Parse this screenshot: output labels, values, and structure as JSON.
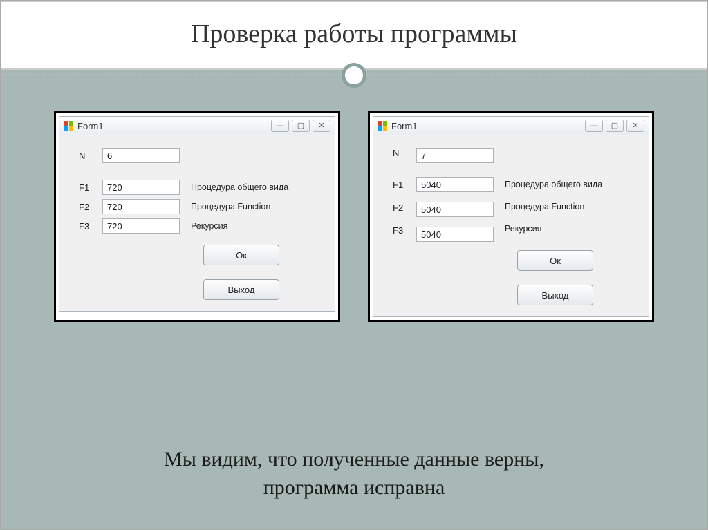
{
  "slide": {
    "title": "Проверка работы программы",
    "caption_l1": "Мы видим, что полученные данные верны,",
    "caption_l2": "программа исправна"
  },
  "window_controls": {
    "minimize": "—",
    "maximize": "▢",
    "close": "✕"
  },
  "form1": {
    "title": "Form1",
    "n_label": "N",
    "n_value": "6",
    "rows": [
      {
        "label": "F1",
        "value": "720",
        "desc": "Процедура общего вида"
      },
      {
        "label": "F2",
        "value": "720",
        "desc": "Процедура Function"
      },
      {
        "label": "F3",
        "value": "720",
        "desc": "Рекурсия"
      }
    ],
    "ok": "Ок",
    "exit": "Выход"
  },
  "form2": {
    "title": "Form1",
    "n_label": "N",
    "n_value": "7",
    "rows": [
      {
        "label": "F1",
        "value": "5040",
        "desc": "Процедура общего вида"
      },
      {
        "label": "F2",
        "value": "5040",
        "desc": "Процедура Function"
      },
      {
        "label": "F3",
        "value": "5040",
        "desc": "Рекурсия"
      }
    ],
    "ok": "Ок",
    "exit": "Выход"
  }
}
